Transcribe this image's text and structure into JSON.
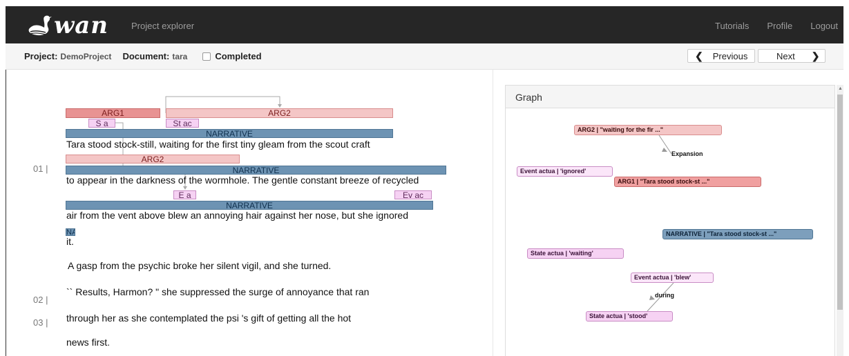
{
  "navbar": {
    "logo_text": "wan",
    "title": "Project explorer",
    "links": [
      "Tutorials",
      "Profile",
      "Logout"
    ]
  },
  "projbar": {
    "project_label": "Project:",
    "project_value": "DemoProject",
    "document_label": "Document:",
    "document_value": "tara",
    "completed_label": "Completed",
    "previous_label": "Previous",
    "next_label": "Next"
  },
  "doc": {
    "line_numbers": [
      "01 |",
      "02 |",
      "03 |"
    ],
    "lines": [
      "Tara stood stock-still, waiting for the first tiny gleam from the scout craft",
      "to appear in the darkness of the wormhole. The gentle constant breeze of recycled",
      "air from the vent above blew an annoying hair against her nose, but she ignored",
      "it.",
      "A gasp from the psychic broke her silent vigil, and she turned.",
      "`` Results, Harmon? \" she suppressed the surge of annoyance that ran",
      "through her as she contemplated the psi 's gift of getting all the hot",
      "news first."
    ],
    "annotations": {
      "arg1": "ARG1",
      "arg2_a": "ARG2",
      "state_a": "S a",
      "state_ac": "St ac",
      "narrative_1": "NARRATIVE",
      "arg2_b": "ARG2",
      "narrative_2": "NARRATIVE",
      "event_a": "E a",
      "event_ac": "Ev ac",
      "narrative_3": "NARRATIVE",
      "narrative_short": "NA"
    }
  },
  "graph": {
    "title": "Graph",
    "nodes": {
      "arg2": "ARG2 | \"waiting for the fir ...\"",
      "event_ignored": "Event actua | 'ignored'",
      "arg1": "ARG1 | \"Tara stood stock-st ...\"",
      "narrative": "NARRATIVE | \"Tara stood stock-st ...\"",
      "state_waiting": "State actua | 'waiting'",
      "event_blew": "Event actua | 'blew'",
      "state_stood": "State actua | 'stood'"
    },
    "edge_labels": {
      "expansion": "Expansion",
      "during": "during"
    }
  },
  "colors": {
    "navbar_bg": "#262626",
    "arg1": "#e89393",
    "arg2": "#f4c6c6",
    "narrative": "#6d93b3",
    "state_event": "#f6d2f3"
  }
}
